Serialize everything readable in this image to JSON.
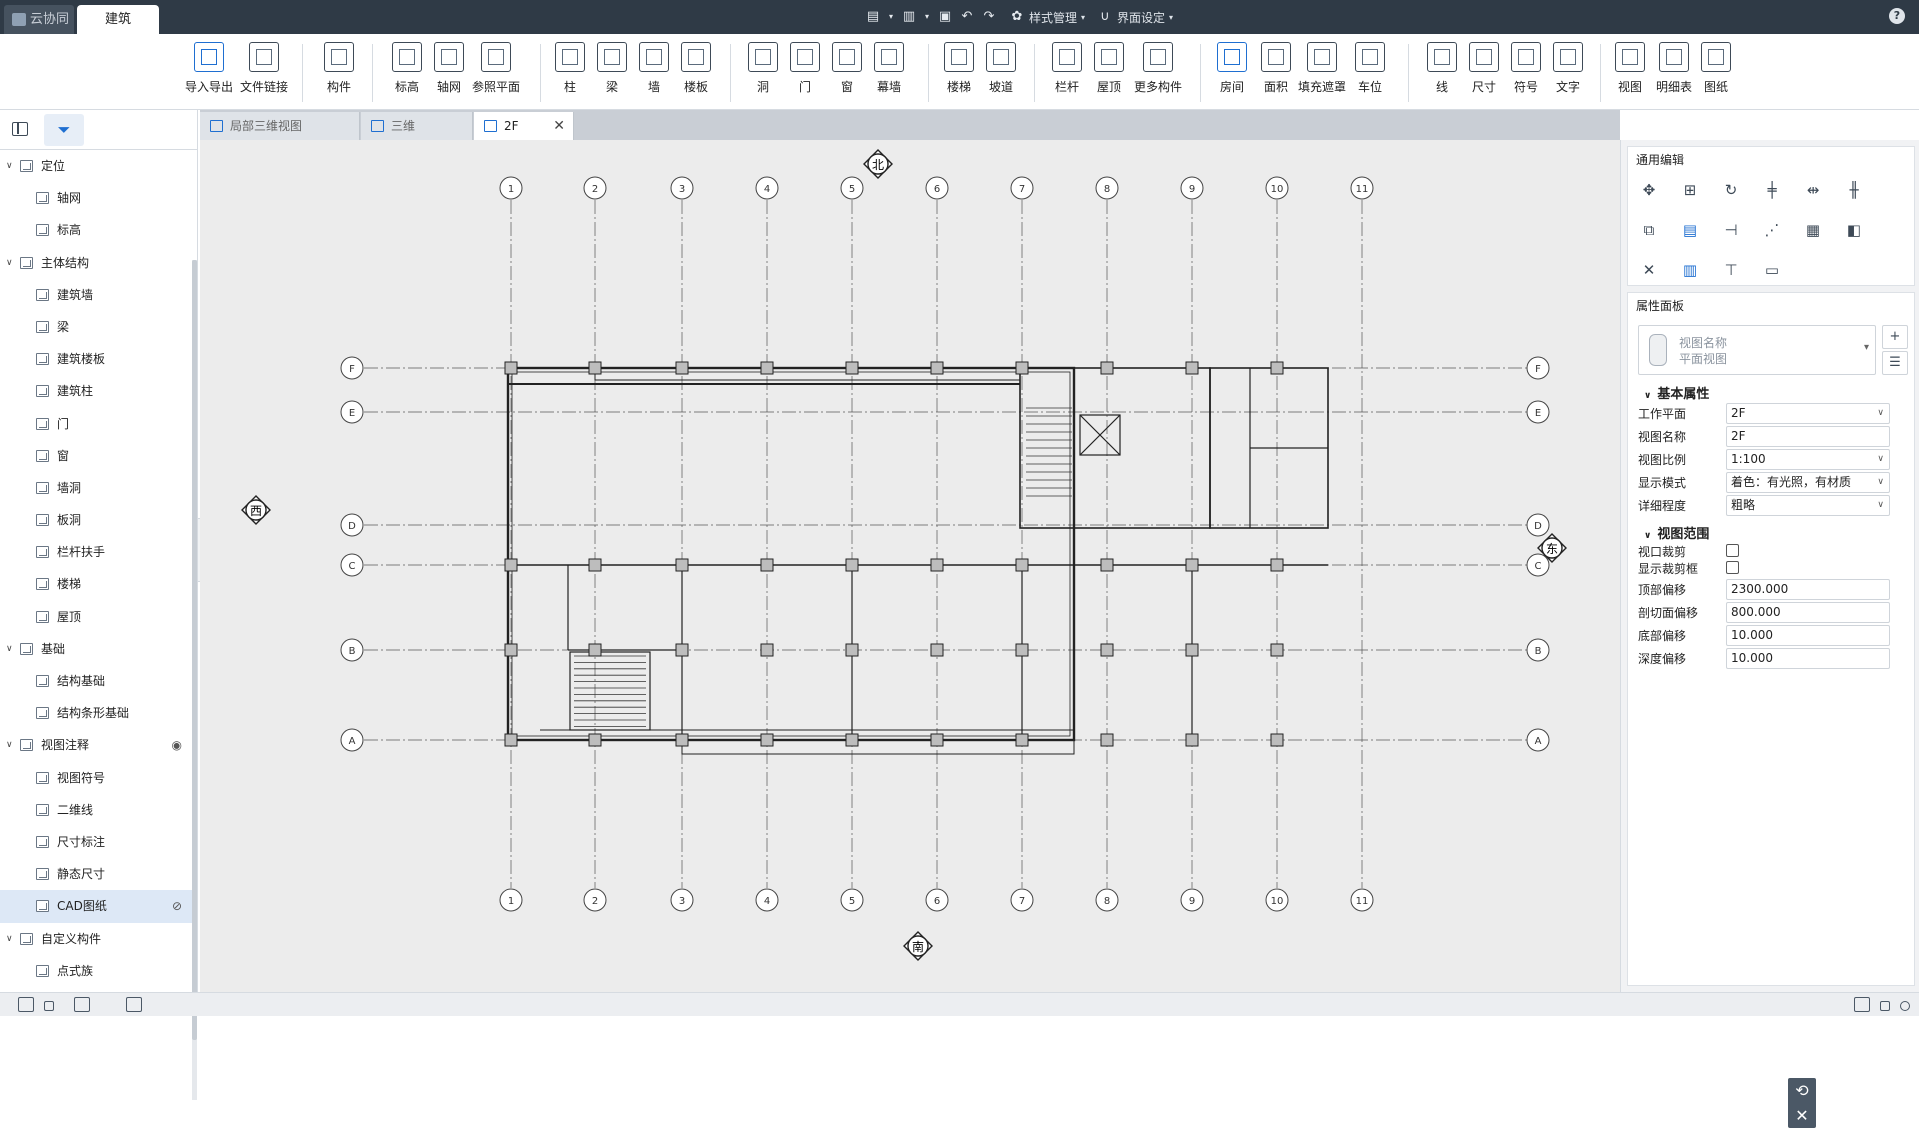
{
  "titlebar": {
    "tabs": [
      "云协同",
      "建筑"
    ],
    "style_menu": "样式管理",
    "ui_menu": "界面设定",
    "help": "?"
  },
  "ribbon": {
    "items": [
      "导入导出",
      "文件链接",
      "构件",
      "标高",
      "轴网",
      "参照平面",
      "柱",
      "梁",
      "墙",
      "楼板",
      "洞",
      "门",
      "窗",
      "幕墙",
      "楼梯",
      "坡道",
      "栏杆",
      "屋顶",
      "更多构件",
      "房间",
      "面积",
      "填充遮罩",
      "车位",
      "线",
      "尺寸",
      "符号",
      "文字",
      "视图",
      "明细表",
      "图纸"
    ]
  },
  "tree": [
    {
      "label": "定位",
      "level": 0
    },
    {
      "label": "轴网",
      "level": 1
    },
    {
      "label": "标高",
      "level": 1
    },
    {
      "label": "主体结构",
      "level": 0
    },
    {
      "label": "建筑墙",
      "level": 1
    },
    {
      "label": "梁",
      "level": 1
    },
    {
      "label": "建筑楼板",
      "level": 1
    },
    {
      "label": "建筑柱",
      "level": 1
    },
    {
      "label": "门",
      "level": 1
    },
    {
      "label": "窗",
      "level": 1
    },
    {
      "label": "墙洞",
      "level": 1
    },
    {
      "label": "板洞",
      "level": 1
    },
    {
      "label": "栏杆扶手",
      "level": 1
    },
    {
      "label": "楼梯",
      "level": 1
    },
    {
      "label": "屋顶",
      "level": 1
    },
    {
      "label": "基础",
      "level": 0
    },
    {
      "label": "结构基础",
      "level": 1
    },
    {
      "label": "结构条形基础",
      "level": 1
    },
    {
      "label": "视图注释",
      "level": 0
    },
    {
      "label": "视图符号",
      "level": 1
    },
    {
      "label": "二维线",
      "level": 1
    },
    {
      "label": "尺寸标注",
      "level": 1
    },
    {
      "label": "静态尺寸",
      "level": 1
    },
    {
      "label": "CAD图纸",
      "level": 1
    },
    {
      "label": "自定义构件",
      "level": 0
    },
    {
      "label": "点式族",
      "level": 1
    }
  ],
  "doc_tabs": [
    "局部三维视图",
    "三维",
    "2F"
  ],
  "drawing": {
    "compass": {
      "north": "北",
      "south": "南",
      "east": "东",
      "west": "西"
    },
    "axes_num": [
      "1",
      "2",
      "3",
      "4",
      "5",
      "6",
      "7",
      "8",
      "9",
      "10",
      "11"
    ],
    "axes_letter": [
      "F",
      "E",
      "D",
      "C",
      "B",
      "A"
    ]
  },
  "panel": {
    "edit_title": "通用编辑",
    "prop_title": "属性面板",
    "view_select": {
      "line1": "视图名称",
      "line2": "平面视图"
    },
    "group_basic": "基本属性",
    "props_basic": [
      {
        "label": "工作平面",
        "value": "2F",
        "select": true
      },
      {
        "label": "视图名称",
        "value": "2F",
        "select": false
      },
      {
        "label": "视图比例",
        "value": "1:100",
        "select": true
      },
      {
        "label": "显示模式",
        "value": "着色：有光照，有材质",
        "select": true
      },
      {
        "label": "详细程度",
        "value": "粗略",
        "select": true
      }
    ],
    "group_range": "视图范围",
    "checks": [
      {
        "label": "视口裁剪"
      },
      {
        "label": "显示裁剪框"
      }
    ],
    "props_range": [
      {
        "label": "顶部偏移",
        "value": "2300.000"
      },
      {
        "label": "剖切面偏移",
        "value": "800.000"
      },
      {
        "label": "底部偏移",
        "value": "10.000"
      },
      {
        "label": "深度偏移",
        "value": "10.000"
      }
    ]
  }
}
